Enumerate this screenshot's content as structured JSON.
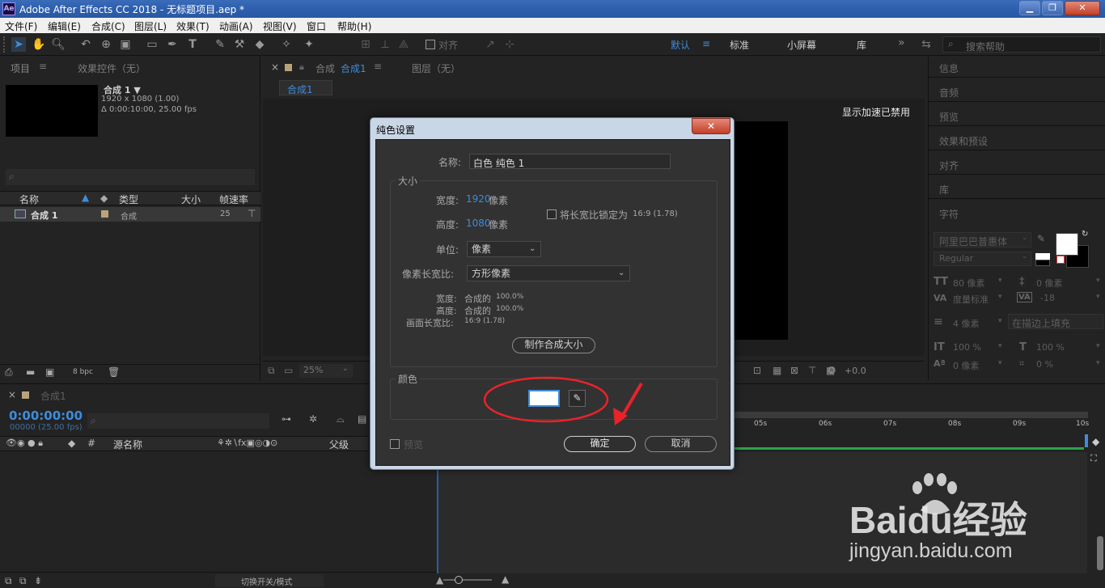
{
  "window": {
    "title": "Adobe After Effects CC 2018 - 无标题项目.aep *",
    "logo": "Ae"
  },
  "menu": [
    "文件(F)",
    "编辑(E)",
    "合成(C)",
    "图层(L)",
    "效果(T)",
    "动画(A)",
    "视图(V)",
    "窗口",
    "帮助(H)"
  ],
  "toolbar": {
    "snap_label": "对齐",
    "workspaces": [
      "默认",
      "标准",
      "小屏幕",
      "库"
    ],
    "more": "»",
    "search_placeholder": "搜索帮助"
  },
  "project_panel": {
    "tab_project": "项目",
    "tab_effects": "效果控件（无）",
    "comp_name": "合成 1 ▼",
    "comp_res": "1920 x 1080 (1.00)",
    "comp_dur": "Δ 0:00:10:00, 25.00 fps",
    "col_name": "名称",
    "col_type": "类型",
    "col_size": "大小",
    "col_fps": "帧速率",
    "item_name": "合成 1",
    "item_type": "合成",
    "item_fps": "25",
    "bpc": "8 bpc"
  },
  "comp_panel": {
    "tab_label": "合成",
    "tab_name": "合成1",
    "tab_layer": "图层（无）",
    "subtab": "合成1",
    "accel_msg": "显示加速已禁用",
    "zoom": "25%",
    "exposure": "+0.0"
  },
  "right_panel": {
    "tabs": [
      "信息",
      "音频",
      "预览",
      "效果和预设",
      "对齐",
      "库",
      "字符"
    ],
    "font": "阿里巴巴普惠体",
    "style": "Regular",
    "size": "80 像素",
    "leading": "0 像素",
    "kerning": "度量标准",
    "tracking": "-18",
    "stroke": "4 像素",
    "stroke_mode": "在描边上填充",
    "vscale": "100 %",
    "hscale": "100 %",
    "baseline": "0 像素",
    "tsume": "0 %"
  },
  "timeline": {
    "tab": "合成1",
    "timecode": "0:00:00:00",
    "frames": "00000 (25.00 fps)",
    "col_source": "源名称",
    "col_parent": "父级",
    "ruler": [
      "05s",
      "06s",
      "07s",
      "08s",
      "09s",
      "10s"
    ],
    "toggle_modes": "切换开关/模式"
  },
  "dialog": {
    "title": "纯色设置",
    "name_label": "名称:",
    "name_value": "白色 纯色 1",
    "size_group": "大小",
    "width_label": "宽度:",
    "width_value": "1920",
    "height_label": "高度:",
    "height_value": "1080",
    "px": "像素",
    "lock_label": "将长宽比锁定为",
    "lock_ratio": "16:9 (1.78)",
    "unit_label": "单位:",
    "unit_value": "像素",
    "par_label": "像素长宽比:",
    "par_value": "方形像素",
    "w_pct_label": "宽度:",
    "w_pct_value": "合成的",
    "w_pct_num": "100.0%",
    "h_pct_label": "高度:",
    "h_pct_value": "合成的",
    "h_pct_num": "100.0%",
    "far_label": "画面长宽比:",
    "far_value": "16:9 (1.78)",
    "make_comp_size": "制作合成大小",
    "color_group": "颜色",
    "color_value": "#ffffff",
    "preview_label": "预览",
    "ok": "确定",
    "cancel": "取消"
  },
  "watermark": {
    "brand": "Baidu经验",
    "url": "jingyan.baidu.com"
  },
  "colors": {
    "accent_blue": "#3f8cdb",
    "annotation_red": "#e8232a"
  }
}
